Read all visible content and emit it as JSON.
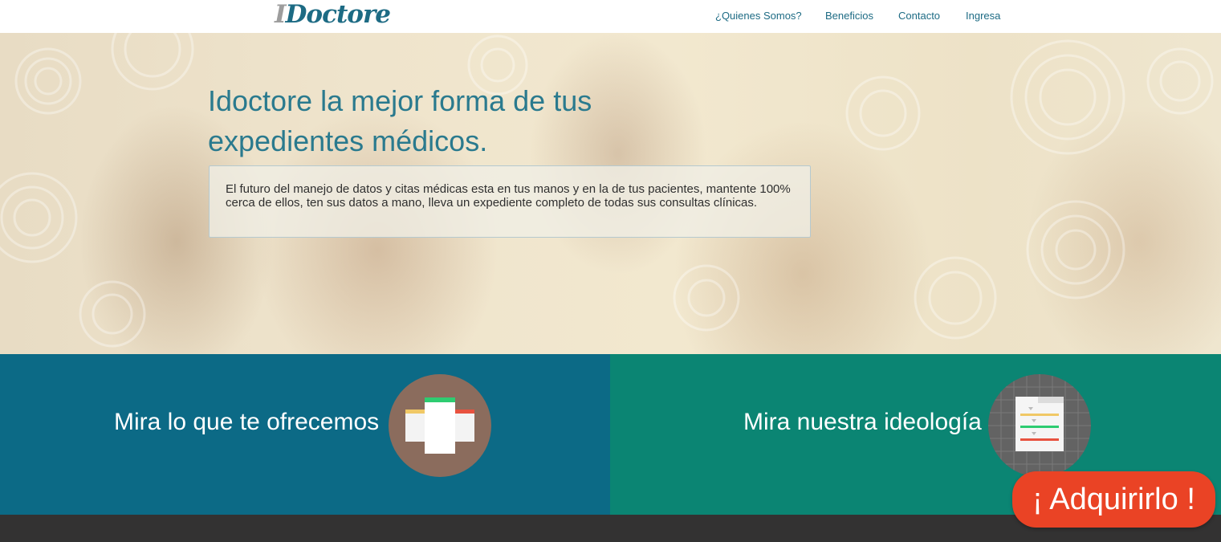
{
  "header": {
    "logo_initial": "I",
    "logo_text": "Doctore",
    "nav": [
      {
        "label": "¿Quienes Somos?"
      },
      {
        "label": "Beneficios"
      },
      {
        "label": "Contacto"
      },
      {
        "label": "Ingresa"
      }
    ]
  },
  "hero": {
    "title_line1": "Idoctore la mejor forma de tus",
    "title_line2": "expedientes médicos.",
    "description": "El futuro del manejo de datos y citas médicas esta en tus manos y en la de tus pacientes, mantente 100% cerca de ellos, ten sus datos a mano, lleva un expediente completo de todas sus consultas clínicas."
  },
  "panels": {
    "left": {
      "title": "Mira lo que te ofrecemos",
      "icon": "cards-icon",
      "color": "#0c6a86"
    },
    "right": {
      "title": "Mira nuestra ideología",
      "icon": "document-list-icon",
      "color": "#0b8573"
    }
  },
  "buy_button": {
    "label": "¡ Adquirirlo !",
    "color": "#ea4325"
  }
}
